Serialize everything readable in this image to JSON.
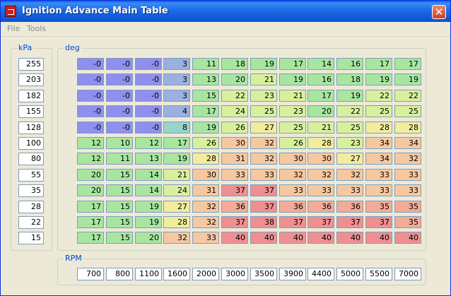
{
  "window": {
    "title": "Ignition Advance Main Table",
    "close_label": "✕"
  },
  "menu": [
    "File",
    "Tools"
  ],
  "kpa_group": {
    "label": "kPa",
    "values": [
      "255",
      "203",
      "182",
      "155",
      "128",
      "100",
      "80",
      "55",
      "35",
      "28",
      "22",
      "15"
    ]
  },
  "deg_group": {
    "label": "deg"
  },
  "rpm_group": {
    "label": "RPM",
    "values": [
      "700",
      "800",
      "1100",
      "1600",
      "2000",
      "3000",
      "3500",
      "3900",
      "4400",
      "5000",
      "5500",
      "7000"
    ]
  },
  "table": [
    [
      "-0",
      "-0",
      "-0",
      "3",
      "11",
      "18",
      "19",
      "17",
      "14",
      "16",
      "17",
      "17"
    ],
    [
      "-0",
      "-0",
      "-0",
      "3",
      "13",
      "20",
      "21",
      "19",
      "16",
      "18",
      "19",
      "19"
    ],
    [
      "-0",
      "-0",
      "-0",
      "3",
      "15",
      "22",
      "23",
      "21",
      "17",
      "19",
      "22",
      "22"
    ],
    [
      "-0",
      "-0",
      "-0",
      "4",
      "17",
      "24",
      "25",
      "23",
      "20",
      "22",
      "25",
      "25"
    ],
    [
      "-0",
      "-0",
      "-0",
      "8",
      "19",
      "26",
      "27",
      "25",
      "21",
      "25",
      "28",
      "28"
    ],
    [
      "12",
      "10",
      "12",
      "17",
      "26",
      "30",
      "32",
      "26",
      "28",
      "23",
      "34",
      "34"
    ],
    [
      "12",
      "11",
      "13",
      "19",
      "28",
      "31",
      "32",
      "30",
      "30",
      "27",
      "34",
      "32"
    ],
    [
      "20",
      "15",
      "14",
      "21",
      "30",
      "33",
      "33",
      "32",
      "32",
      "32",
      "33",
      "33"
    ],
    [
      "20",
      "15",
      "14",
      "24",
      "31",
      "37",
      "37",
      "33",
      "33",
      "33",
      "33",
      "33"
    ],
    [
      "17",
      "15",
      "19",
      "27",
      "32",
      "36",
      "37",
      "36",
      "36",
      "36",
      "35",
      "35"
    ],
    [
      "17",
      "15",
      "19",
      "28",
      "32",
      "37",
      "38",
      "37",
      "37",
      "37",
      "37",
      "35"
    ],
    [
      "17",
      "15",
      "20",
      "32",
      "33",
      "40",
      "40",
      "40",
      "40",
      "40",
      "40",
      "40"
    ]
  ]
}
